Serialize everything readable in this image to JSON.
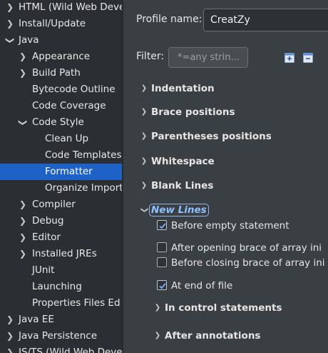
{
  "tree": [
    {
      "label": "HTML (Wild Web Deve",
      "indent": 0,
      "chevron": "right"
    },
    {
      "label": "Install/Update",
      "indent": 0,
      "chevron": "right"
    },
    {
      "label": "Java",
      "indent": 0,
      "chevron": "down"
    },
    {
      "label": "Appearance",
      "indent": 1,
      "chevron": "right"
    },
    {
      "label": "Build Path",
      "indent": 1,
      "chevron": "right"
    },
    {
      "label": "Bytecode Outline",
      "indent": 1,
      "chevron": ""
    },
    {
      "label": "Code Coverage",
      "indent": 1,
      "chevron": ""
    },
    {
      "label": "Code Style",
      "indent": 1,
      "chevron": "down"
    },
    {
      "label": "Clean Up",
      "indent": 2,
      "chevron": ""
    },
    {
      "label": "Code Templates",
      "indent": 2,
      "chevron": ""
    },
    {
      "label": "Formatter",
      "indent": 2,
      "chevron": "",
      "selected": true
    },
    {
      "label": "Organize Import",
      "indent": 2,
      "chevron": ""
    },
    {
      "label": "Compiler",
      "indent": 1,
      "chevron": "right"
    },
    {
      "label": "Debug",
      "indent": 1,
      "chevron": "right"
    },
    {
      "label": "Editor",
      "indent": 1,
      "chevron": "right"
    },
    {
      "label": "Installed JREs",
      "indent": 1,
      "chevron": "right"
    },
    {
      "label": "JUnit",
      "indent": 1,
      "chevron": ""
    },
    {
      "label": "Launching",
      "indent": 1,
      "chevron": ""
    },
    {
      "label": "Properties Files Ed",
      "indent": 1,
      "chevron": ""
    },
    {
      "label": "Java EE",
      "indent": 0,
      "chevron": "right"
    },
    {
      "label": "Java Persistence",
      "indent": 0,
      "chevron": "right"
    },
    {
      "label": "JS/TS (Wild Web Deve",
      "indent": 0,
      "chevron": "right"
    }
  ],
  "profile": {
    "label": "Profile name:",
    "value": "CreatZy"
  },
  "filter": {
    "label": "Filter:",
    "placeholder": "*=any strin..."
  },
  "toolbar": {
    "expand_icon": "expand-all-icon",
    "collapse_icon": "collapse-all-icon"
  },
  "sections": [
    {
      "label": "Indentation",
      "expanded": false
    },
    {
      "label": "Brace positions",
      "expanded": false
    },
    {
      "label": "Parentheses positions",
      "expanded": false
    },
    {
      "label": "Whitespace",
      "expanded": false
    },
    {
      "label": "Blank Lines",
      "expanded": false
    },
    {
      "label": "New Lines",
      "expanded": true,
      "focused": true
    }
  ],
  "new_lines_options": [
    {
      "label": "Before empty statement",
      "checked": true
    },
    {
      "label": "After opening brace of array ini",
      "checked": false
    },
    {
      "label": "Before closing brace of array ini",
      "checked": false
    },
    {
      "label": "At end of file",
      "checked": true
    }
  ],
  "subsections": [
    {
      "label": "In control statements",
      "expanded": false
    },
    {
      "label": "After annotations",
      "expanded": false
    }
  ],
  "colors": {
    "selection": "#1e62c8",
    "focus_text": "#8fc0ff"
  }
}
